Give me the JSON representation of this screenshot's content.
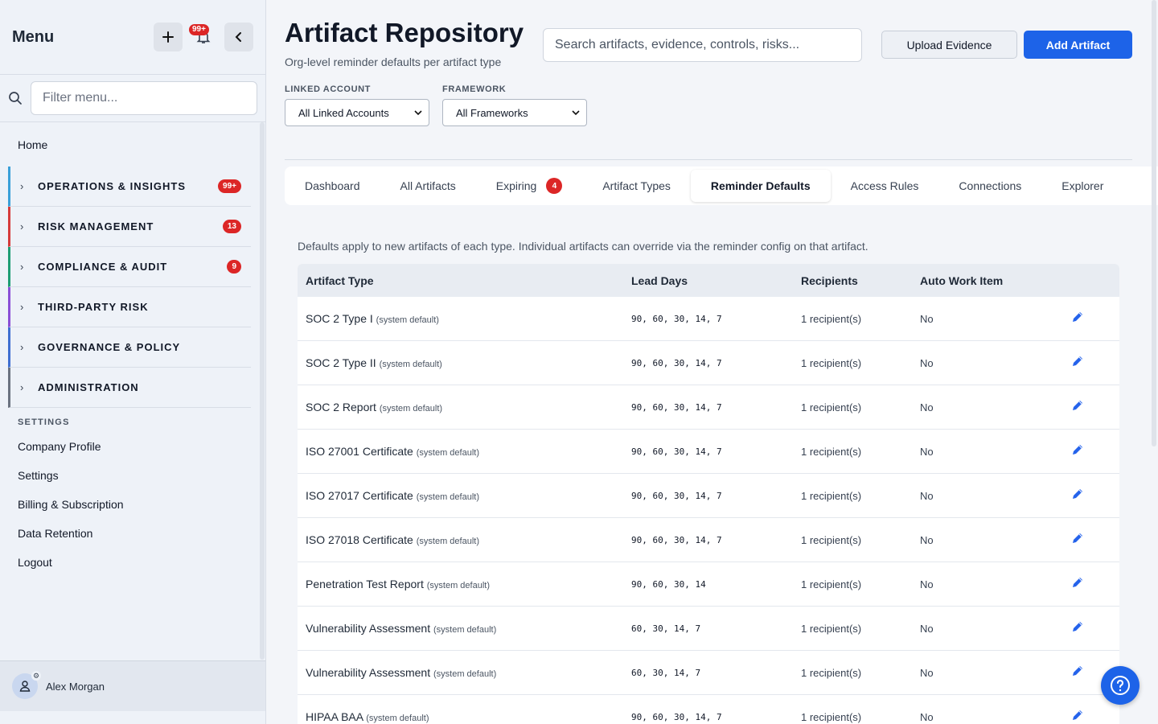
{
  "sidebar": {
    "title": "Menu",
    "notif_badge": "99+",
    "filter_placeholder": "Filter menu...",
    "home": "Home",
    "groups": [
      {
        "label": "OPERATIONS & INSIGHTS",
        "badge": "99+",
        "color": "#3aa0d8"
      },
      {
        "label": "RISK MANAGEMENT",
        "badge": "13",
        "color": "#d63b3b"
      },
      {
        "label": "COMPLIANCE & AUDIT",
        "badge": "9",
        "color": "#1f9d74"
      },
      {
        "label": "THIRD-PARTY RISK",
        "badge": "",
        "color": "#8b4fd6"
      },
      {
        "label": "GOVERNANCE & POLICY",
        "badge": "",
        "color": "#3f6fd1"
      },
      {
        "label": "ADMINISTRATION",
        "badge": "",
        "color": "#6b7280"
      }
    ],
    "settings_label": "SETTINGS",
    "links": [
      "Company Profile",
      "Settings",
      "Billing & Subscription",
      "Data Retention",
      "Logout"
    ],
    "user": "Alex Morgan"
  },
  "header": {
    "title": "Artifact Repository",
    "subtitle": "Org-level reminder defaults per artifact type",
    "search_placeholder": "Search artifacts, evidence, controls, risks...",
    "upload_label": "Upload Evidence",
    "add_label": "Add Artifact"
  },
  "filters": {
    "account_label": "LINKED ACCOUNT",
    "account_value": "All Linked Accounts",
    "framework_label": "FRAMEWORK",
    "framework_value": "All Frameworks"
  },
  "tabs": [
    {
      "label": "Dashboard",
      "badge": ""
    },
    {
      "label": "All Artifacts",
      "badge": ""
    },
    {
      "label": "Expiring",
      "badge": "4"
    },
    {
      "label": "Artifact Types",
      "badge": ""
    },
    {
      "label": "Reminder Defaults",
      "badge": "",
      "active": true
    },
    {
      "label": "Access Rules",
      "badge": ""
    },
    {
      "label": "Connections",
      "badge": ""
    },
    {
      "label": "Explorer",
      "badge": ""
    }
  ],
  "note": "Defaults apply to new artifacts of each type. Individual artifacts can override via the reminder config on that artifact.",
  "table": {
    "headers": [
      "Artifact Type",
      "Lead Days",
      "Recipients",
      "Auto Work Item"
    ],
    "rows": [
      {
        "type": "SOC 2 Type I",
        "tag": "(system default)",
        "lead": "90, 60, 30, 14, 7",
        "recipients": "1 recipient(s)",
        "auto": "No"
      },
      {
        "type": "SOC 2 Type II",
        "tag": "(system default)",
        "lead": "90, 60, 30, 14, 7",
        "recipients": "1 recipient(s)",
        "auto": "No"
      },
      {
        "type": "SOC 2 Report",
        "tag": "(system default)",
        "lead": "90, 60, 30, 14, 7",
        "recipients": "1 recipient(s)",
        "auto": "No"
      },
      {
        "type": "ISO 27001 Certificate",
        "tag": "(system default)",
        "lead": "90, 60, 30, 14, 7",
        "recipients": "1 recipient(s)",
        "auto": "No"
      },
      {
        "type": "ISO 27017 Certificate",
        "tag": "(system default)",
        "lead": "90, 60, 30, 14, 7",
        "recipients": "1 recipient(s)",
        "auto": "No"
      },
      {
        "type": "ISO 27018 Certificate",
        "tag": "(system default)",
        "lead": "90, 60, 30, 14, 7",
        "recipients": "1 recipient(s)",
        "auto": "No"
      },
      {
        "type": "Penetration Test Report",
        "tag": "(system default)",
        "lead": "90, 60, 30, 14",
        "recipients": "1 recipient(s)",
        "auto": "No"
      },
      {
        "type": "Vulnerability Assessment",
        "tag": "(system default)",
        "lead": "60, 30, 14, 7",
        "recipients": "1 recipient(s)",
        "auto": "No"
      },
      {
        "type": "Vulnerability Assessment",
        "tag": "(system default)",
        "lead": "60, 30, 14, 7",
        "recipients": "1 recipient(s)",
        "auto": "No"
      },
      {
        "type": "HIPAA BAA",
        "tag": "(system default)",
        "lead": "90, 60, 30, 14, 7",
        "recipients": "1 recipient(s)",
        "auto": "No"
      }
    ]
  },
  "colors": {
    "accent": "#1d63e8",
    "badge": "#dc2626"
  }
}
